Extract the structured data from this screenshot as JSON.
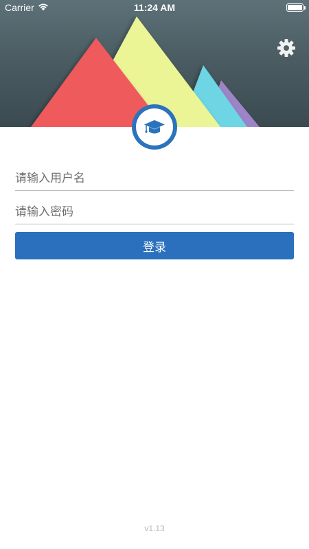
{
  "status_bar": {
    "carrier": "Carrier",
    "time": "11:24 AM"
  },
  "header": {
    "settings_icon": "gear-icon",
    "logo_icon": "graduation-cap-icon"
  },
  "form": {
    "username_placeholder": "请输入用户名",
    "password_placeholder": "请输入密码",
    "login_label": "登录"
  },
  "footer": {
    "version": "v1.13"
  },
  "colors": {
    "primary": "#2a70bd",
    "header_bg": "#4b5d63",
    "peak_red": "#ef5a5c",
    "peak_yellow": "#ebf596",
    "peak_cyan": "#6dd5e3",
    "peak_purple": "#9d84c6"
  }
}
